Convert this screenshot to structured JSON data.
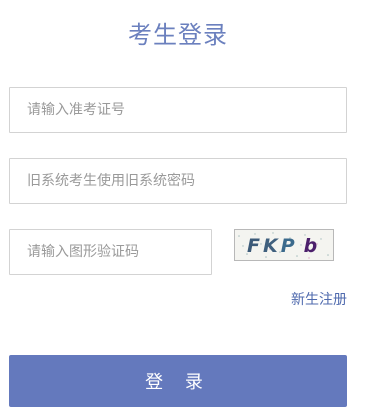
{
  "page": {
    "title": "考生登录"
  },
  "form": {
    "exam_id_placeholder": "请输入准考证号",
    "password_placeholder": "旧系统考生使用旧系统密码",
    "captcha_placeholder": "请输入图形验证码",
    "captcha_text": "FKPb"
  },
  "links": {
    "register": "新生注册"
  },
  "buttons": {
    "login": "登 录"
  },
  "colors": {
    "accent": "#6479bd",
    "title": "#6b80be",
    "link": "#4f6aae"
  }
}
